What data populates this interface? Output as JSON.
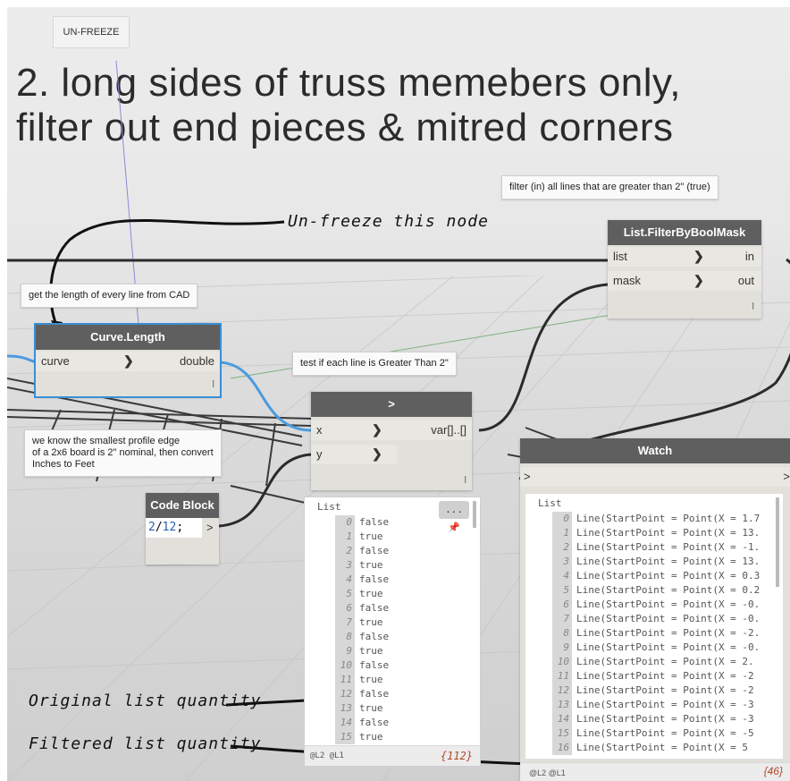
{
  "freeze_button": "UN-FREEZE",
  "title_line1": "2. long sides of truss memebers only,",
  "title_line2": "filter out end pieces & mitred corners",
  "notes": {
    "filter": "filter (in) all lines that are greater than 2\" (true)",
    "length": "get the length of every line from CAD",
    "test": "test if each line is Greater Than 2\"",
    "smallest1": "we know the smallest profile edge",
    "smallest2": "of a 2x6 board is 2\" nominal, then convert",
    "smallest3": "Inches to Feet"
  },
  "annotations": {
    "unfreeze": "Un-freeze this node",
    "original": "Original list quantity",
    "filtered": "Filtered list quantity"
  },
  "filter_node": {
    "title": "List.FilterByBoolMask",
    "in1": "list",
    "in2": "mask",
    "out1": "in",
    "out2": "out",
    "lacing": "l"
  },
  "curve_node": {
    "title": "Curve.Length",
    "in1": "curve",
    "out1": "double",
    "lacing": "l"
  },
  "gt_node": {
    "title": ">",
    "in1": "x",
    "in2": "y",
    "out1": "var[]..[]",
    "lacing": "l"
  },
  "code_node": {
    "title": "Code Block",
    "num": "2",
    "op": "/",
    "den": "12",
    "end": ";",
    "out": ">"
  },
  "watch_node": {
    "title": "Watch",
    "in": ">",
    "out": ">"
  },
  "bool_list": {
    "header": "List",
    "items": [
      {
        "i": "0",
        "v": "false"
      },
      {
        "i": "1",
        "v": "true"
      },
      {
        "i": "2",
        "v": "false"
      },
      {
        "i": "3",
        "v": "true"
      },
      {
        "i": "4",
        "v": "false"
      },
      {
        "i": "5",
        "v": "true"
      },
      {
        "i": "6",
        "v": "false"
      },
      {
        "i": "7",
        "v": "true"
      },
      {
        "i": "8",
        "v": "false"
      },
      {
        "i": "9",
        "v": "true"
      },
      {
        "i": "10",
        "v": "false"
      },
      {
        "i": "11",
        "v": "true"
      },
      {
        "i": "12",
        "v": "false"
      },
      {
        "i": "13",
        "v": "true"
      },
      {
        "i": "14",
        "v": "false"
      },
      {
        "i": "15",
        "v": "true"
      }
    ],
    "levels": "@L2 @L1",
    "count": "{112}",
    "menu": "..."
  },
  "watch_list": {
    "header": "List",
    "items": [
      {
        "i": "0",
        "v": "Line(StartPoint = Point(X = 1.7"
      },
      {
        "i": "1",
        "v": "Line(StartPoint = Point(X = 13."
      },
      {
        "i": "2",
        "v": "Line(StartPoint = Point(X = -1."
      },
      {
        "i": "3",
        "v": "Line(StartPoint = Point(X = 13."
      },
      {
        "i": "4",
        "v": "Line(StartPoint = Point(X = 0.3"
      },
      {
        "i": "5",
        "v": "Line(StartPoint = Point(X = 0.2"
      },
      {
        "i": "6",
        "v": "Line(StartPoint = Point(X = -0."
      },
      {
        "i": "7",
        "v": "Line(StartPoint = Point(X = -0."
      },
      {
        "i": "8",
        "v": "Line(StartPoint = Point(X = -2."
      },
      {
        "i": "9",
        "v": "Line(StartPoint = Point(X = -0."
      },
      {
        "i": "10",
        "v": "Line(StartPoint = Point(X = 2."
      },
      {
        "i": "11",
        "v": "Line(StartPoint = Point(X = -2"
      },
      {
        "i": "12",
        "v": "Line(StartPoint = Point(X = -2"
      },
      {
        "i": "13",
        "v": "Line(StartPoint = Point(X = -3"
      },
      {
        "i": "14",
        "v": "Line(StartPoint = Point(X = -3"
      },
      {
        "i": "15",
        "v": "Line(StartPoint = Point(X = -5"
      },
      {
        "i": "16",
        "v": "Line(StartPoint = Point(X = 5"
      }
    ],
    "levels": "@L2 @L1",
    "count": "{46}"
  },
  "colors": {
    "wire_selected": "#4a9be0",
    "wire": "#2b2b2b",
    "node_header": "#5f5f5f",
    "node_body": "#e2e0da"
  }
}
